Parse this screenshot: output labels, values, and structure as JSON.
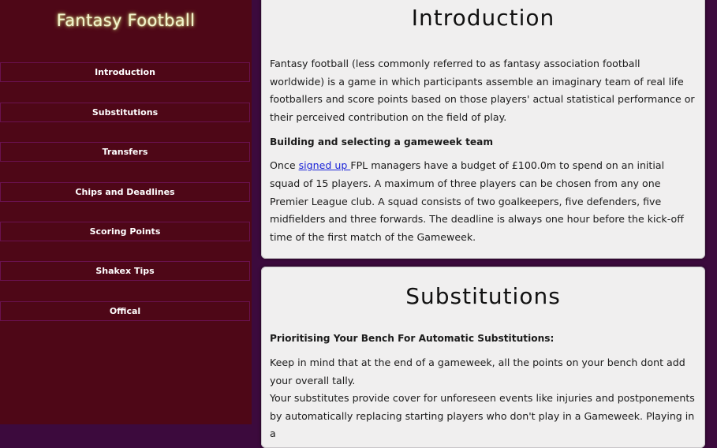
{
  "sidebar": {
    "title": "Fantasy Football",
    "items": [
      {
        "label": "Introduction"
      },
      {
        "label": "Substitutions"
      },
      {
        "label": "Transfers"
      },
      {
        "label": "Chips and Deadlines"
      },
      {
        "label": "Scoring Points"
      },
      {
        "label": "Shakex Tips"
      },
      {
        "label": "Offical"
      }
    ]
  },
  "introduction": {
    "heading": "Introduction",
    "paragraph1": "Fantasy football (less commonly referred to as fantasy association football worldwide) is a game in which participants assemble an imaginary team of real life footballers and score points based on those players' actual statistical performance or their perceived contribution on the field of play.",
    "subheading": "Building and selecting a gameweek team",
    "p2_prefix": "Once ",
    "p2_link": "signed up ",
    "p2_rest": "FPL managers have a budget of £100.0m to spend on an initial squad of 15 players. A maximum of three players can be chosen from any one Premier League club. A squad consists of two goalkeepers, five defenders, five midfielders and three forwards. The deadline is always one hour before the kick-off time of the first match of the Gameweek."
  },
  "substitutions": {
    "heading": "Substitutions",
    "subheading": "Prioritising Your Bench For Automatic Substitutions:",
    "paragraph1": "Keep in mind that at the end of a gameweek, all the points on your bench dont add your overall tally.",
    "paragraph2": "Your substitutes provide cover for unforeseen events like injuries and postponements by automatically replacing starting players who don't play in a Gameweek. Playing in a"
  },
  "colors": {
    "page_bg": "#3c0a3d",
    "sidebar_bg": "#4e0717",
    "nav_border": "#6a1150",
    "title_glow": "#f3f6cf",
    "card_bg": "#f0efef",
    "link": "#1b24d8"
  }
}
